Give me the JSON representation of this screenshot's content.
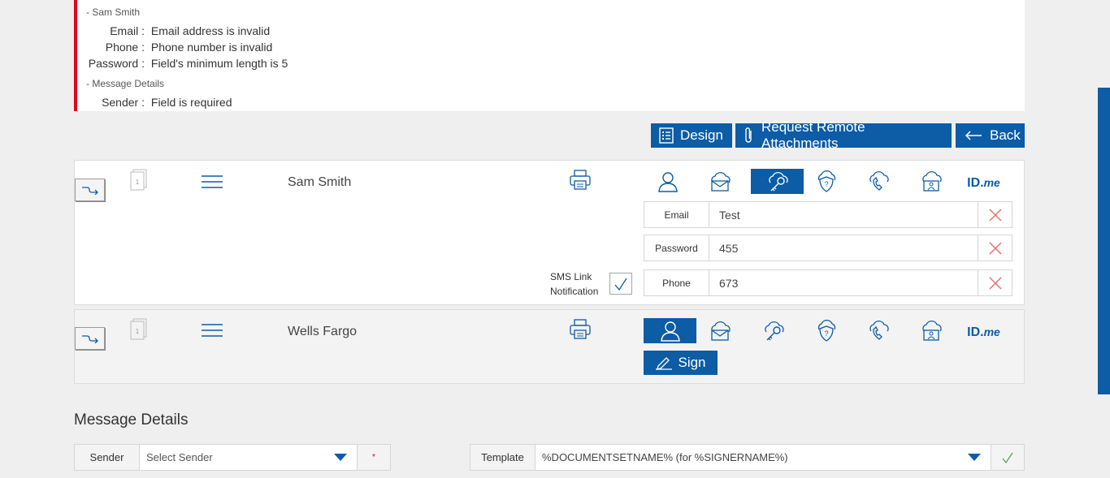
{
  "errors": {
    "groups": [
      {
        "title": "- Sam Smith",
        "items": [
          {
            "label": "Email :",
            "message": "Email address is invalid"
          },
          {
            "label": "Phone :",
            "message": "Phone number is invalid"
          },
          {
            "label": "Password :",
            "message": "Field's minimum length is 5"
          }
        ]
      },
      {
        "title": "- Message Details",
        "items": [
          {
            "label": "Sender :",
            "message": "Field is required"
          }
        ]
      }
    ]
  },
  "toolbar": {
    "design_label": "Design",
    "request_attachments_label": "Request Remote Attachments",
    "back_label": "Back"
  },
  "signers": [
    {
      "name": "Sam Smith",
      "page_number": "1",
      "active_auth": "password-auth",
      "fields": [
        {
          "label": "Email",
          "value": "Test"
        },
        {
          "label": "Password",
          "value": "455"
        },
        {
          "label": "Phone",
          "value": "673"
        }
      ],
      "sms_label_line1": "SMS Link",
      "sms_label_line2": "Notification",
      "sms_checked": true
    },
    {
      "name": "Wells Fargo",
      "page_number": "1",
      "active_auth": "user-auth",
      "sign_label": "Sign"
    }
  ],
  "auth_options": [
    "user-icon",
    "email-cloud-icon",
    "key-cloud-icon",
    "shield-question-icon",
    "phone-cloud-icon",
    "id-card-cloud-icon",
    "idme-logo"
  ],
  "idme": {
    "id": "ID.",
    "me": "me"
  },
  "message_details": {
    "title": "Message Details",
    "sender_label": "Sender",
    "sender_placeholder": "Select Sender",
    "required_mark": "*",
    "template_label": "Template",
    "template_value": "%DOCUMENTSETNAME% (for %SIGNERNAME%)"
  },
  "colors": {
    "primary": "#0d5ca6",
    "error": "#e3001b",
    "delete": "#e0736f",
    "ok": "#5a9a5a"
  }
}
